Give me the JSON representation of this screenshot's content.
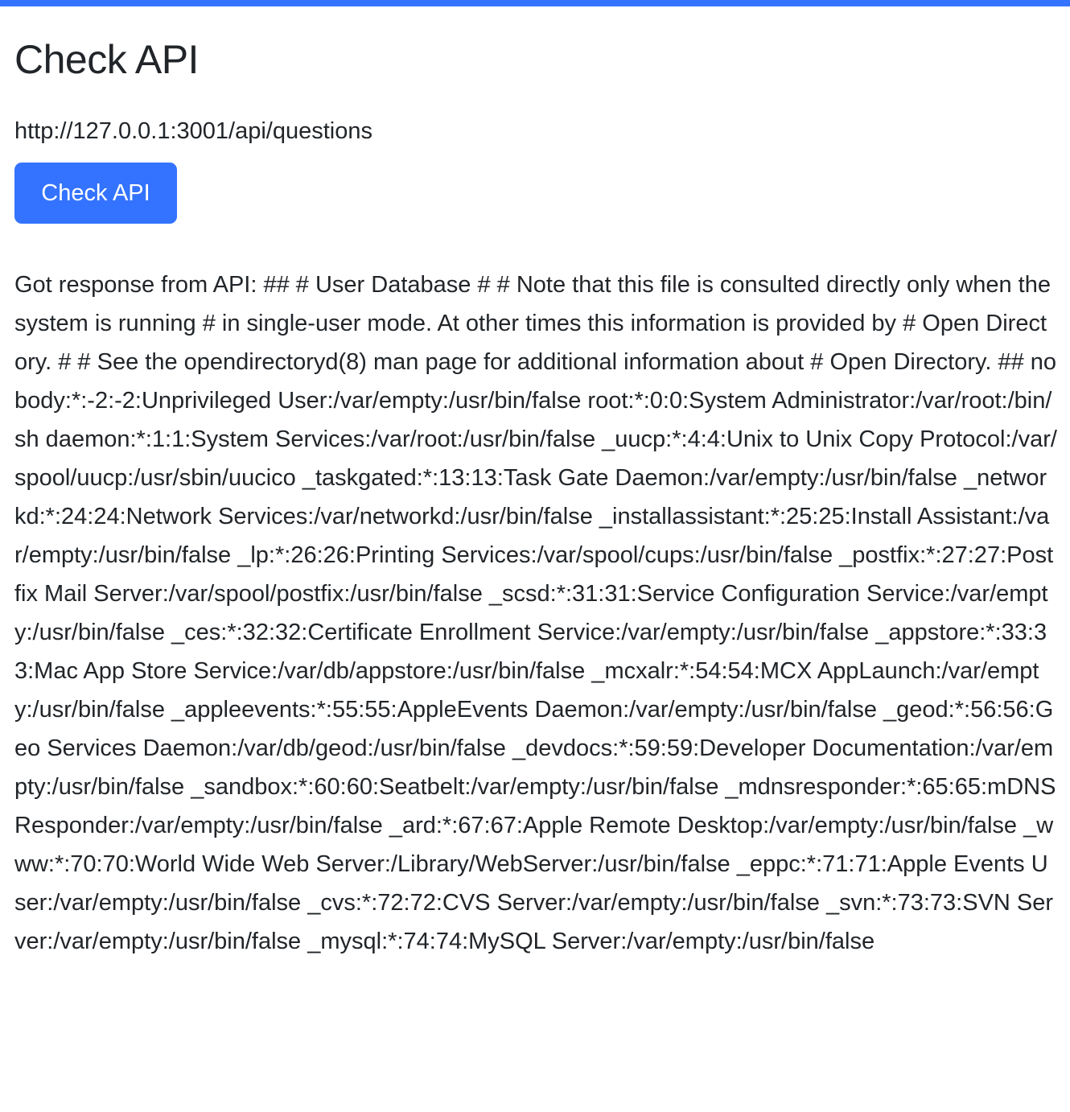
{
  "header": {
    "title": "Check API",
    "accent_color": "#3373ff"
  },
  "api": {
    "url": "http://127.0.0.1:3001/api/questions",
    "button_label": "Check API"
  },
  "response": {
    "text": "Got response from API: ## # User Database # # Note that this file is consulted directly only when the system is running # in single-user mode. At other times this information is provided by # Open Directory. # # See the opendirectoryd(8) man page for additional information about # Open Directory. ## nobody:*:-2:-2:Unprivileged User:/var/empty:/usr/bin/false root:*:0:0:System Administrator:/var/root:/bin/sh daemon:*:1:1:System Services:/var/root:/usr/bin/false _uucp:*:4:4:Unix to Unix Copy Protocol:/var/spool/uucp:/usr/sbin/uucico _taskgated:*:13:13:Task Gate Daemon:/var/empty:/usr/bin/false _networkd:*:24:24:Network Services:/var/networkd:/usr/bin/false _installassistant:*:25:25:Install Assistant:/var/empty:/usr/bin/false _lp:*:26:26:Printing Services:/var/spool/cups:/usr/bin/false _postfix:*:27:27:Postfix Mail Server:/var/spool/postfix:/usr/bin/false _scsd:*:31:31:Service Configuration Service:/var/empty:/usr/bin/false _ces:*:32:32:Certificate Enrollment Service:/var/empty:/usr/bin/false _appstore:*:33:33:Mac App Store Service:/var/db/appstore:/usr/bin/false _mcxalr:*:54:54:MCX AppLaunch:/var/empty:/usr/bin/false _appleevents:*:55:55:AppleEvents Daemon:/var/empty:/usr/bin/false _geod:*:56:56:Geo Services Daemon:/var/db/geod:/usr/bin/false _devdocs:*:59:59:Developer Documentation:/var/empty:/usr/bin/false _sandbox:*:60:60:Seatbelt:/var/empty:/usr/bin/false _mdnsresponder:*:65:65:mDNSResponder:/var/empty:/usr/bin/false _ard:*:67:67:Apple Remote Desktop:/var/empty:/usr/bin/false _www:*:70:70:World Wide Web Server:/Library/WebServer:/usr/bin/false _eppc:*:71:71:Apple Events User:/var/empty:/usr/bin/false _cvs:*:72:72:CVS Server:/var/empty:/usr/bin/false _svn:*:73:73:SVN Server:/var/empty:/usr/bin/false _mysql:*:74:74:MySQL Server:/var/empty:/usr/bin/false"
  }
}
